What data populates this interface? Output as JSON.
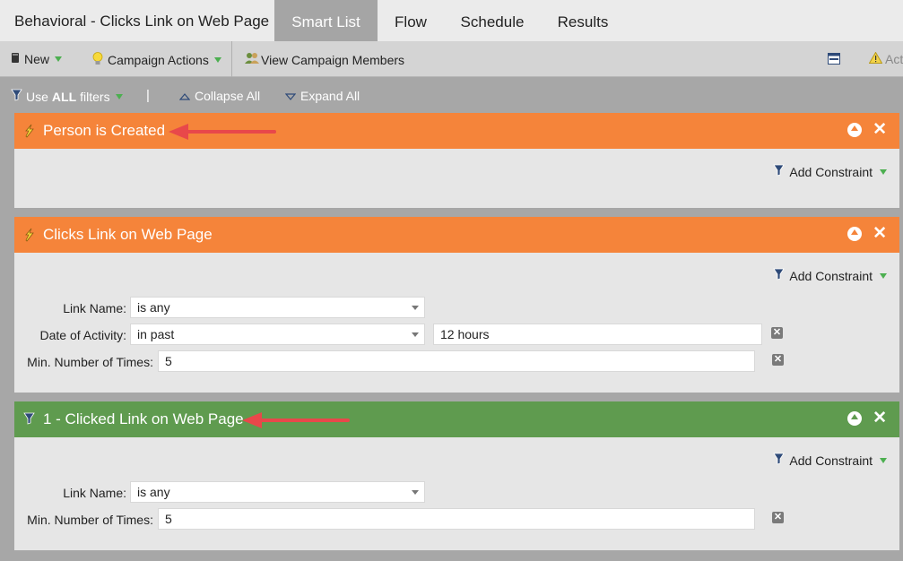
{
  "header": {
    "title": "Behavioral - Clicks Link on Web Page",
    "tabs": [
      {
        "label": "Smart List",
        "active": true
      },
      {
        "label": "Flow"
      },
      {
        "label": "Schedule"
      },
      {
        "label": "Results"
      }
    ]
  },
  "toolbar": {
    "new_label": "New",
    "campaign_actions_label": "Campaign Actions",
    "view_members_label": "View Campaign Members",
    "truncated_right_label": "Act"
  },
  "filterbar": {
    "use_label_pre": "Use",
    "use_label_bold": "ALL",
    "use_label_post": "filters",
    "separator": "|",
    "collapse_label": "Collapse All",
    "expand_label": "Expand All"
  },
  "filters": [
    {
      "title": "Person is Created",
      "color": "#f5843a",
      "add_constraint": "Add Constraint"
    },
    {
      "title": "Clicks Link on Web Page",
      "color": "#f5843a",
      "add_constraint": "Add Constraint",
      "rows": [
        {
          "label": "Link Name:",
          "operator": "is any"
        },
        {
          "label": "Date of Activity:",
          "operator": "in past",
          "value": "12 hours"
        },
        {
          "label": "Min. Number of Times:",
          "value": "5"
        }
      ]
    },
    {
      "title": "1 - Clicked Link on Web Page",
      "color": "#5f9b4f",
      "add_constraint": "Add Constraint",
      "rows": [
        {
          "label": "Link Name:",
          "operator": "is any"
        },
        {
          "label": "Min. Number of Times:",
          "value": "5"
        }
      ]
    }
  ],
  "colors": {
    "accent_orange": "#f5843a",
    "accent_green": "#5f9b4f",
    "arrow_red": "#e8484a"
  }
}
